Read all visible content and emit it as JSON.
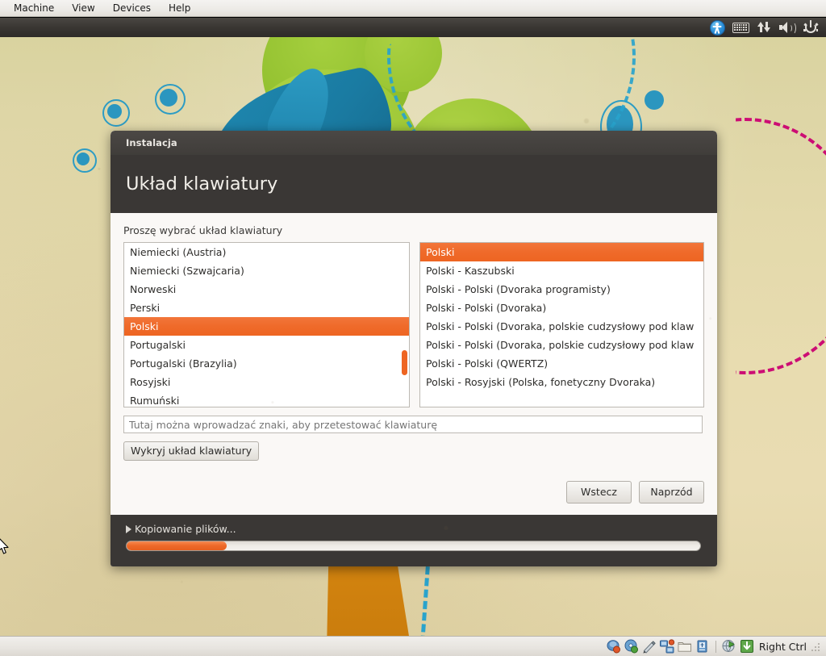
{
  "host_menubar": {
    "items": [
      {
        "label": "Machine",
        "name": "menu-machine"
      },
      {
        "label": "View",
        "name": "menu-view"
      },
      {
        "label": "Devices",
        "name": "menu-devices"
      },
      {
        "label": "Help",
        "name": "menu-help"
      }
    ]
  },
  "guest_panel": {
    "indicators": [
      {
        "icon": "accessibility-icon"
      },
      {
        "icon": "keyboard-indicator-icon"
      },
      {
        "icon": "network-icon"
      },
      {
        "icon": "volume-icon"
      },
      {
        "icon": "power-icon"
      }
    ]
  },
  "dialog": {
    "window_title": "Instalacja",
    "heading": "Układ klawiatury",
    "prompt": "Proszę wybrać układ klawiatury",
    "layout_list": {
      "selected": "Polski",
      "items": [
        "Niemiecki (Austria)",
        "Niemiecki (Szwajcaria)",
        "Norweski",
        "Perski",
        "Polski",
        "Portugalski",
        "Portugalski (Brazylia)",
        "Rosyjski",
        "Rumuński"
      ]
    },
    "variant_list": {
      "selected": "Polski",
      "items": [
        "Polski",
        "Polski - Kaszubski",
        "Polski - Polski (Dvoraka programisty)",
        "Polski - Polski (Dvoraka)",
        "Polski - Polski (Dvoraka, polskie cudzysłowy pod klaw",
        "Polski - Polski (Dvoraka, polskie cudzysłowy pod klaw",
        "Polski - Polski (QWERTZ)",
        "Polski - Rosyjski (Polska, fonetyczny Dvoraka)"
      ]
    },
    "test_input": {
      "value": "",
      "placeholder": "Tutaj można wprowadzać znaki, aby przetestować klawiaturę"
    },
    "detect_button": "Wykryj układ klawiatury",
    "back_button": "Wstecz",
    "next_button": "Naprzód",
    "progress": {
      "label": "Kopiowanie plików...",
      "percent": 17.5
    },
    "accent_color": "#ee6522"
  },
  "status_bar": {
    "icons": [
      {
        "icon": "hard-disk-icon"
      },
      {
        "icon": "optical-drive-icon"
      },
      {
        "icon": "floppy-drive-icon"
      },
      {
        "icon": "network-adapter-icon"
      },
      {
        "icon": "shared-folders-icon"
      },
      {
        "icon": "usb-icon"
      },
      {
        "icon": "remote-display-icon"
      },
      {
        "icon": "mouse-capture-icon"
      }
    ],
    "host_key": "Right Ctrl"
  }
}
